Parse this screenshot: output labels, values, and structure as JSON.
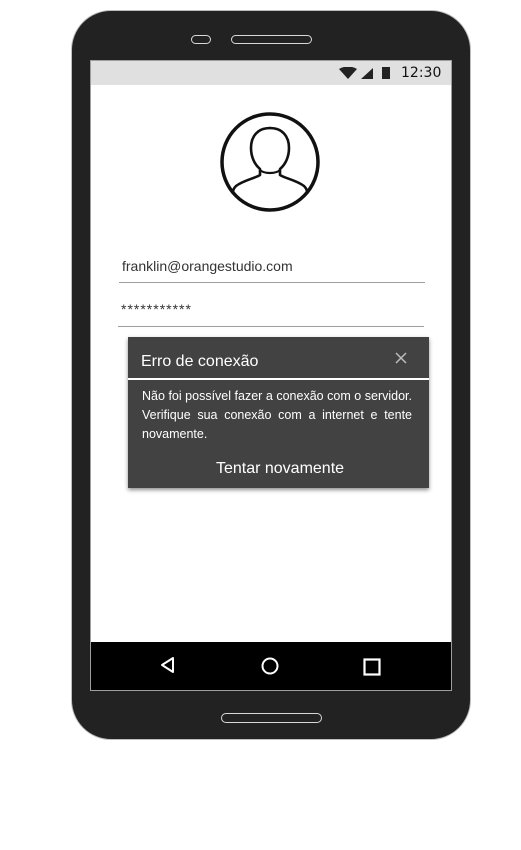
{
  "status_bar": {
    "time": "12:30",
    "icons": [
      "wifi-icon",
      "cell-signal-icon",
      "battery-icon"
    ]
  },
  "login": {
    "avatar_icon": "user-avatar-icon",
    "email_value": "franklin@orangestudio.com",
    "password_value": "***********"
  },
  "dialog": {
    "title": "Erro de conexão",
    "message": "Não foi possível fazer a conexão com o servidor. Verifique sua conexão com a internet e tente novamente.",
    "retry_label": "Tentar novamente",
    "close_icon": "close-icon"
  },
  "nav_bar": {
    "buttons": [
      "back-icon",
      "home-icon",
      "recents-icon"
    ]
  },
  "colors": {
    "phone_body": "#222222",
    "status_bar": "#e0e0e0",
    "dialog_bg": "#424242",
    "nav_bar": "#000000"
  }
}
